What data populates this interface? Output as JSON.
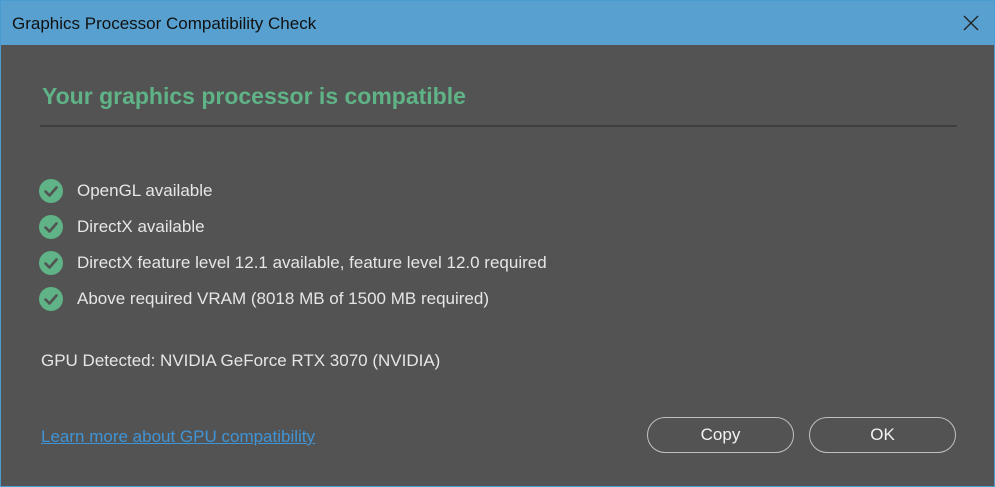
{
  "window": {
    "title": "Graphics Processor Compatibility Check",
    "close_icon": "close-icon"
  },
  "main": {
    "heading": "Your graphics processor is compatible",
    "checks": [
      {
        "icon": "check-circle-icon",
        "label": "OpenGL available"
      },
      {
        "icon": "check-circle-icon",
        "label": "DirectX available"
      },
      {
        "icon": "check-circle-icon",
        "label": "DirectX feature level 12.1 available, feature level 12.0 required"
      },
      {
        "icon": "check-circle-icon",
        "label": "Above required VRAM (8018 MB of 1500 MB required)"
      }
    ],
    "gpu_detected": "GPU Detected: NVIDIA GeForce RTX 3070 (NVIDIA)"
  },
  "footer": {
    "learn_more_link": "Learn more about GPU compatibility",
    "copy_label": "Copy",
    "ok_label": "OK"
  },
  "colors": {
    "titlebar": "#58a0cf",
    "background": "#535353",
    "accent_green": "#5fb386",
    "link": "#3f94d6",
    "text": "#e6e6e6"
  }
}
